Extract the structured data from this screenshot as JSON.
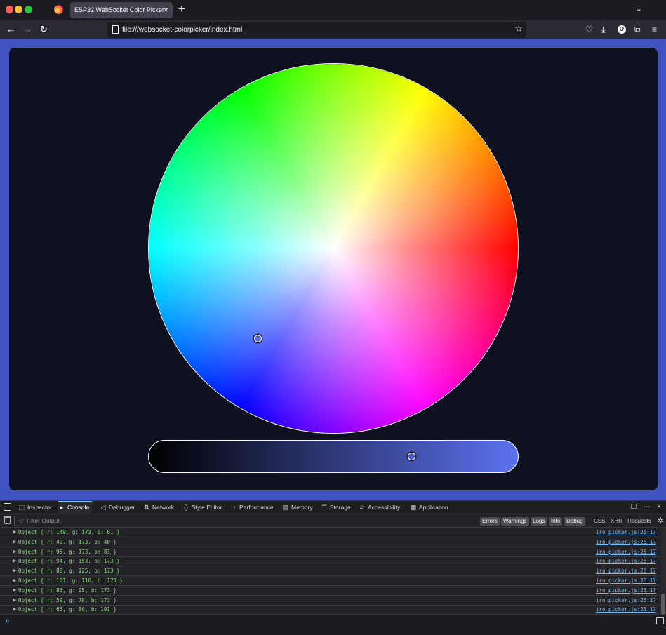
{
  "browser": {
    "tab_title": "ESP32 WebSocket Color Picker",
    "tab_close": "×",
    "new_tab": "+",
    "tab_list": "⌄",
    "url": "file:///websocket-colorpicker/index.html"
  },
  "nav": {
    "back": "←",
    "forward": "→",
    "reload": "↻",
    "star": "☆",
    "pocket": "♡",
    "download": "⤓",
    "account": "O",
    "extensions": "⧉",
    "menu": "≡"
  },
  "colors": {
    "page_background": "#4052c0",
    "card_background": "#0f1120",
    "selected_color": "#5d6cd6"
  },
  "picker": {
    "selected_rgb": {
      "r": 65,
      "g": 86,
      "b": 191
    },
    "brightness": 0.73
  },
  "devtools": {
    "tabs": [
      {
        "label": "Inspector",
        "icon": "⬚"
      },
      {
        "label": "Console",
        "icon": "▸"
      },
      {
        "label": "Debugger",
        "icon": "◁"
      },
      {
        "label": "Network",
        "icon": "⇅"
      },
      {
        "label": "Style Editor",
        "icon": "{}"
      },
      {
        "label": "Performance",
        "icon": "◔"
      },
      {
        "label": "Memory",
        "icon": "▤"
      },
      {
        "label": "Storage",
        "icon": "☰"
      },
      {
        "label": "Accessibility",
        "icon": "☺"
      },
      {
        "label": "Application",
        "icon": "▦"
      }
    ],
    "filter_placeholder": "Filter Output",
    "filter_icon": "▽",
    "levels": [
      "Errors",
      "Warnings",
      "Logs",
      "Info",
      "Debug"
    ],
    "extra_filters": [
      "CSS",
      "XHR",
      "Requests"
    ],
    "dock_icon": "⧠",
    "more_icon": "⋯",
    "close_icon": "×",
    "gear_icon": "✲",
    "prompt": "»",
    "logs": [
      {
        "text": "Object { r: 149, g: 173, b: 61 }",
        "source": "iro_picker.js:25:17"
      },
      {
        "text": "Object { r: 40, g: 173, b: 40 }",
        "source": "iro_picker.js:25:17"
      },
      {
        "text": "Object { r: 95, g: 173, b: 83 }",
        "source": "iro_picker.js:25:17"
      },
      {
        "text": "Object { r: 94, g: 153, b: 173 }",
        "source": "iro_picker.js:25:17"
      },
      {
        "text": "Object { r: 88, g: 125, b: 173 }",
        "source": "iro_picker.js:25:17"
      },
      {
        "text": "Object { r: 101, g: 116, b: 173 }",
        "source": "iro_picker.js:25:17"
      },
      {
        "text": "Object { r: 83, g: 95, b: 173 }",
        "source": "iro_picker.js:25:17"
      },
      {
        "text": "Object { r: 59, g: 78, b: 173 }",
        "source": "iro_picker.js:25:17"
      },
      {
        "text": "Object { r: 65, g: 86, b: 191 }",
        "source": "iro_picker.js:25:17"
      }
    ]
  }
}
